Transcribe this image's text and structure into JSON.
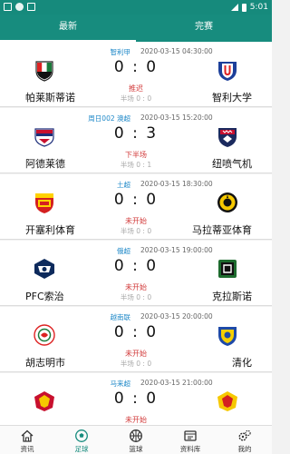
{
  "status_bar": {
    "time": "5:01"
  },
  "tabs": [
    {
      "label": "最新",
      "active": true
    },
    {
      "label": "完赛",
      "active": false
    }
  ],
  "matches": [
    {
      "league": "智利甲",
      "time": "2020-03-15 04:30:00",
      "home": "帕莱斯蒂诺",
      "away": "智利大学",
      "score": "0 : 0",
      "status": "推迟",
      "half": "半场 0 : 0"
    },
    {
      "league": "周日002 澳超",
      "time": "2020-03-15 15:20:00",
      "home": "阿德莱德",
      "away": "纽喷气机",
      "score": "0 : 3",
      "status": "下半场",
      "half": "半场 0 : 1"
    },
    {
      "league": "土超",
      "time": "2020-03-15 18:30:00",
      "home": "开塞利体育",
      "away": "马拉蒂亚体育",
      "score": "0 : 0",
      "status": "未开始",
      "half": "半场 0 : 0"
    },
    {
      "league": "俄超",
      "time": "2020-03-15 19:00:00",
      "home": "PFC索治",
      "away": "克拉斯诺",
      "score": "0 : 0",
      "status": "未开始",
      "half": "半场 0 : 0"
    },
    {
      "league": "越南联",
      "time": "2020-03-15 20:00:00",
      "home": "胡志明市",
      "away": "清化",
      "score": "0 : 0",
      "status": "未开始",
      "half": "半场 0 : 0"
    },
    {
      "league": "马来超",
      "time": "2020-03-15 21:00:00",
      "home": "",
      "away": "",
      "score": "0 : 0",
      "status": "未开始",
      "half": ""
    }
  ],
  "bottom_nav": [
    {
      "label": "资讯",
      "icon": "home-icon",
      "active": false
    },
    {
      "label": "足球",
      "icon": "soccer-ball-icon",
      "active": true
    },
    {
      "label": "篮球",
      "icon": "basketball-icon",
      "active": false
    },
    {
      "label": "资料库",
      "icon": "database-icon",
      "active": false
    },
    {
      "label": "我的",
      "icon": "gears-icon",
      "active": false
    }
  ],
  "colors": {
    "primary": "#178c7e",
    "league": "#1e88c8",
    "status": "#d23a3a"
  }
}
